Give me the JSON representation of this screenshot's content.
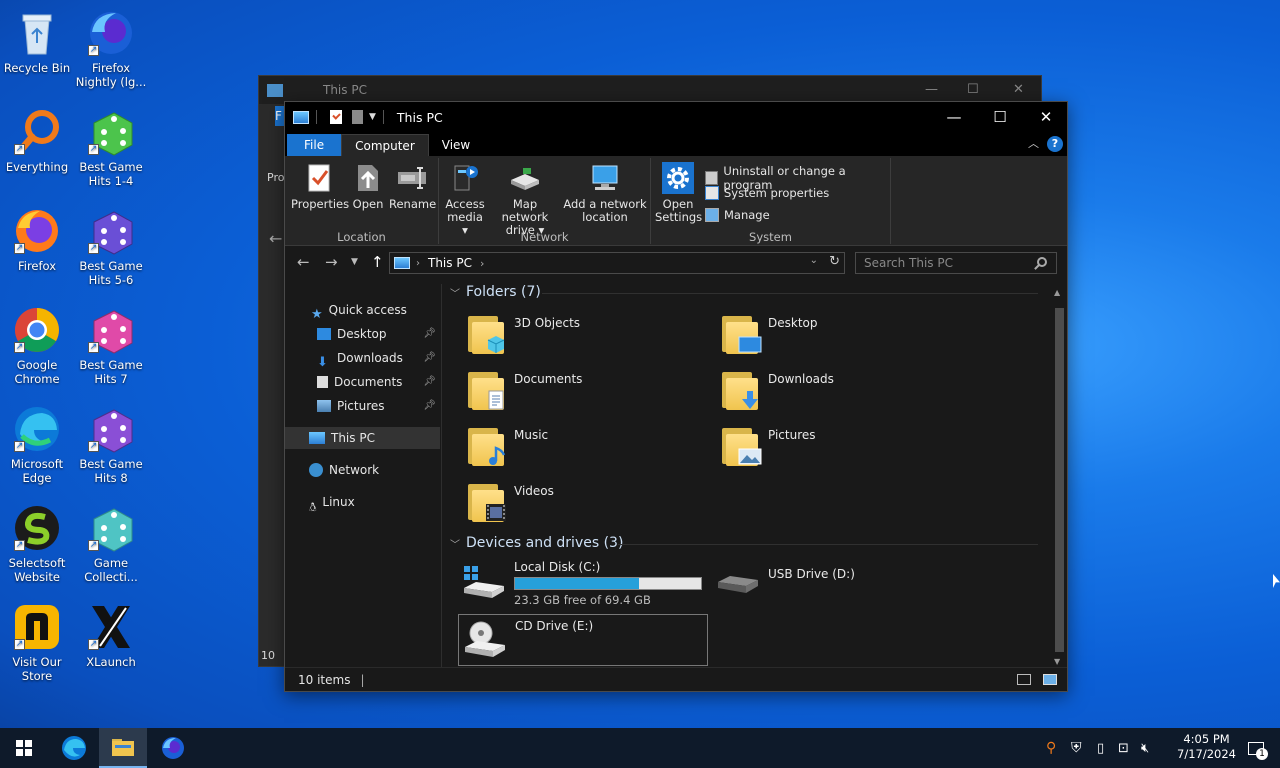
{
  "desktop": {
    "icons": [
      {
        "label": "Recycle Bin"
      },
      {
        "label": "Firefox Nightly (lg..."
      },
      {
        "label": "Everything"
      },
      {
        "label": "Best Game Hits 1-4"
      },
      {
        "label": "Firefox"
      },
      {
        "label": "Best Game Hits 5-6"
      },
      {
        "label": "Google Chrome"
      },
      {
        "label": "Best Game Hits 7"
      },
      {
        "label": "Microsoft Edge"
      },
      {
        "label": "Best Game Hits 8"
      },
      {
        "label": "Selectsoft Website"
      },
      {
        "label": "Game Collecti..."
      },
      {
        "label": "Visit Our Store"
      },
      {
        "label": "XLaunch"
      }
    ]
  },
  "back_window": {
    "title": "This PC",
    "left_fragments": [
      "F",
      "Pro",
      "10"
    ]
  },
  "window": {
    "title": "This PC",
    "tabs": [
      {
        "label": "File"
      },
      {
        "label": "Computer"
      },
      {
        "label": "View"
      }
    ],
    "help": "?",
    "ribbon": {
      "location": {
        "label": "Location",
        "buttons": [
          {
            "label": "Properties"
          },
          {
            "label": "Open"
          },
          {
            "label": "Rename"
          }
        ]
      },
      "network": {
        "label": "Network",
        "buttons": [
          {
            "line1": "Access",
            "line2": "media ▾"
          },
          {
            "line1": "Map network",
            "line2": "drive ▾"
          },
          {
            "line1": "Add a network",
            "line2": "location"
          }
        ]
      },
      "system": {
        "label": "System",
        "open_settings": {
          "line1": "Open",
          "line2": "Settings"
        },
        "small": [
          {
            "label": "Uninstall or change a program"
          },
          {
            "label": "System properties"
          },
          {
            "label": "Manage"
          }
        ]
      }
    },
    "address": {
      "path": "This PC",
      "search_placeholder": "Search This PC"
    },
    "nav": {
      "quick_access": "Quick access",
      "items": [
        {
          "label": "Desktop"
        },
        {
          "label": "Downloads"
        },
        {
          "label": "Documents"
        },
        {
          "label": "Pictures"
        }
      ],
      "this_pc": "This PC",
      "network": "Network",
      "linux": "Linux"
    },
    "folders": {
      "header": "Folders (7)",
      "items": [
        {
          "name": "3D Objects"
        },
        {
          "name": "Desktop"
        },
        {
          "name": "Documents"
        },
        {
          "name": "Downloads"
        },
        {
          "name": "Music"
        },
        {
          "name": "Pictures"
        },
        {
          "name": "Videos"
        }
      ]
    },
    "drives": {
      "header": "Devices and drives (3)",
      "items": [
        {
          "name": "Local Disk (C:)",
          "free": "23.3 GB free of 69.4 GB",
          "used_fraction": 0.664
        },
        {
          "name": "USB Drive (D:)"
        },
        {
          "name": "CD Drive (E:)"
        }
      ]
    },
    "status": {
      "count": "10 items"
    }
  },
  "taskbar": {
    "time": "4:05 PM",
    "date": "7/17/2024",
    "notifications": "1"
  },
  "colors": {
    "accent": "#1a73cf",
    "drive_fill": "#26a0da",
    "taskbar": "#0e1a2a"
  }
}
